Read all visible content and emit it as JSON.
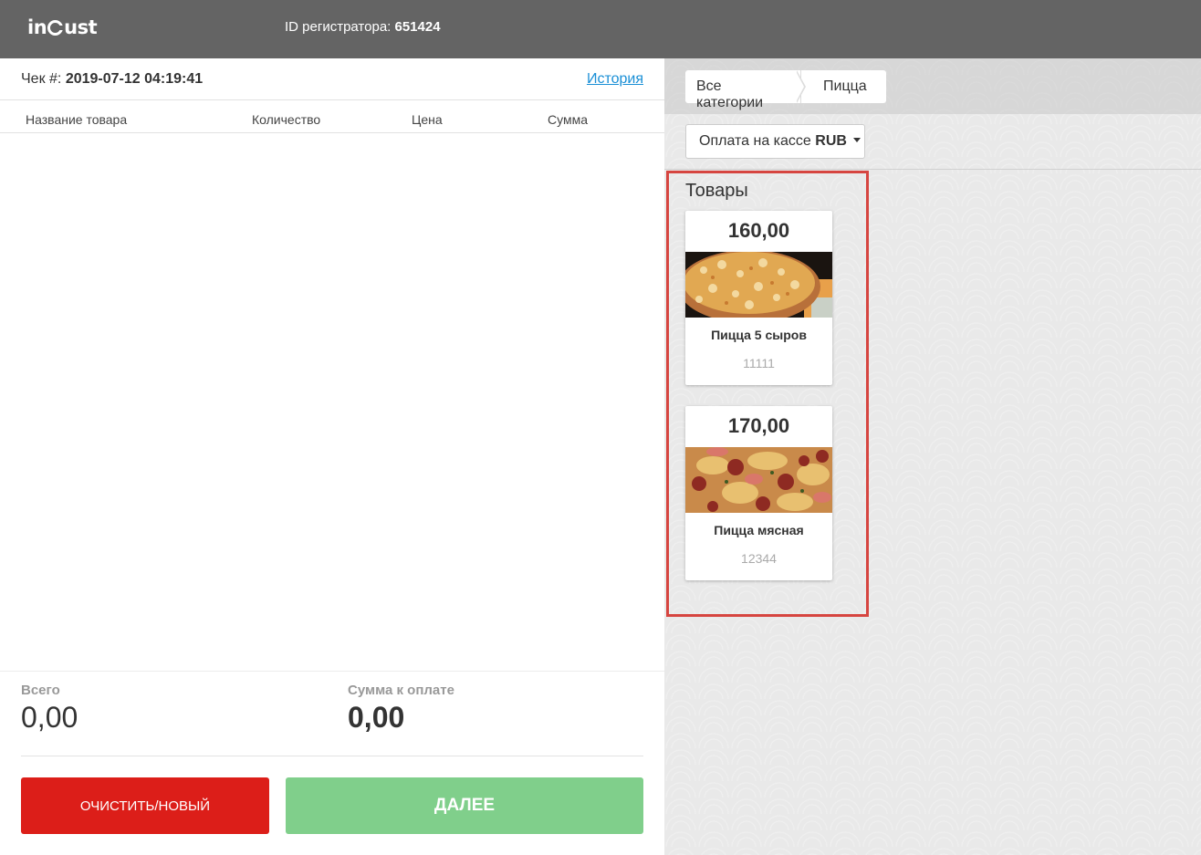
{
  "header": {
    "logo_text": "incust",
    "registrar_label": "ID регистратора:",
    "registrar_id": "651424"
  },
  "receipt": {
    "check_label": "Чек #:",
    "check_value": "2019-07-12 04:19:41",
    "history_link": "История",
    "columns": {
      "name": "Название товара",
      "quantity": "Количество",
      "price": "Цена",
      "sum": "Сумма"
    },
    "total_label": "Всего",
    "total_value": "0,00",
    "payable_label": "Сумма к оплате",
    "payable_value": "0,00",
    "clear_button": "ОЧИСТИТЬ/НОВЫЙ",
    "next_button": "ДАЛЕЕ"
  },
  "catalog": {
    "breadcrumbs": [
      "Все категории",
      "Пицца"
    ],
    "payment_label": "Оплата на кассе",
    "payment_currency": "RUB",
    "section_title": "Товары",
    "products": [
      {
        "price": "160,00",
        "name": "Пицца 5 сыров",
        "code": "11111",
        "image": "pizza-cheese-image"
      },
      {
        "price": "170,00",
        "name": "Пицца мясная",
        "code": "12344",
        "image": "pizza-meat-image"
      }
    ]
  },
  "colors": {
    "topbar": "#646464",
    "clear_button": "#dc1e19",
    "next_button": "#80cf8b",
    "link": "#1a8fd6",
    "highlight_border": "#d64540"
  }
}
